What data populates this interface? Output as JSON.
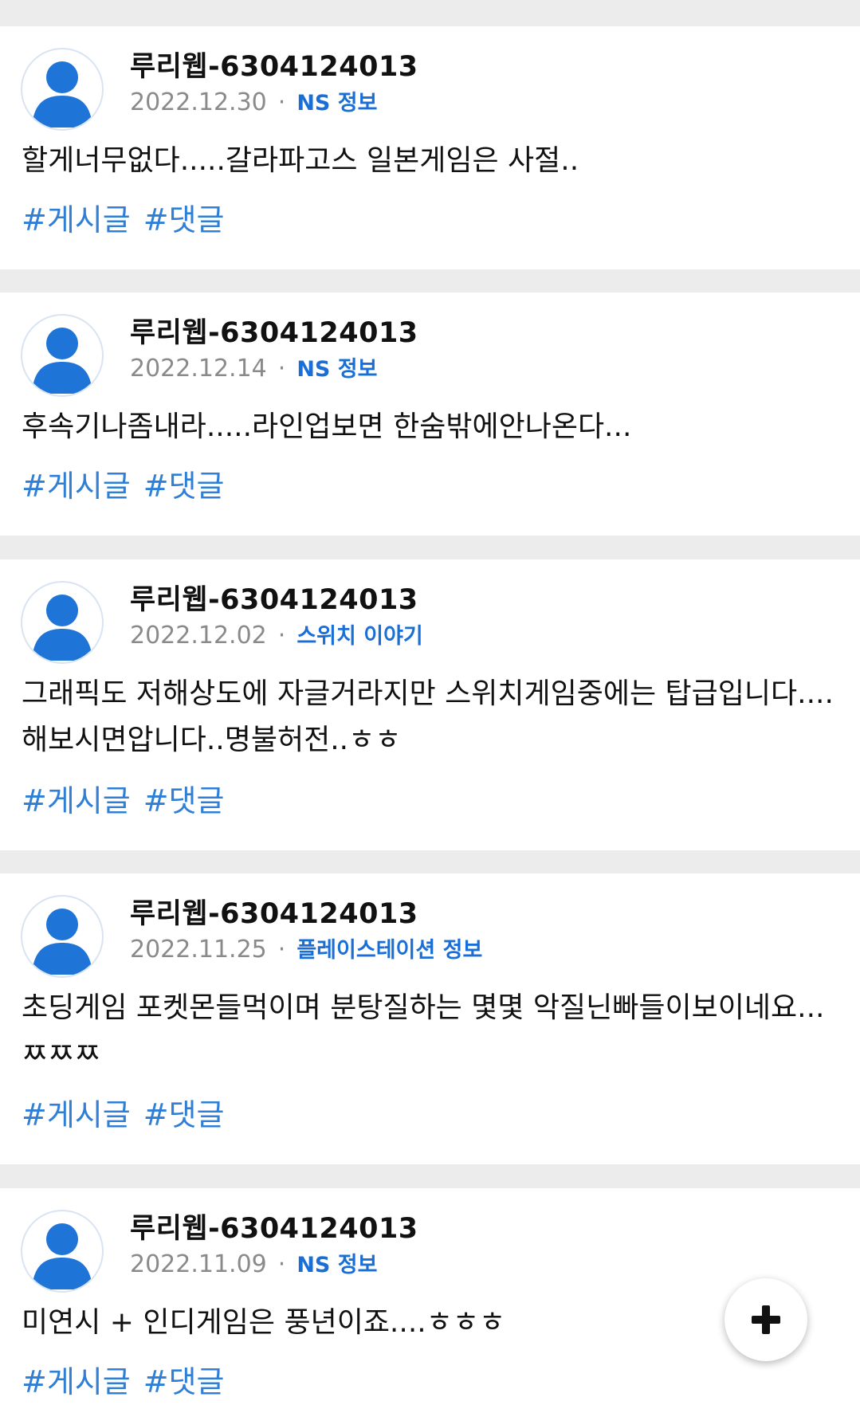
{
  "posts": [
    {
      "author": "루리웹-6304124013",
      "date": "2022.12.30",
      "category": "NS 정보",
      "text": "할게너무없다.....갈라파고스 일본게임은 사절..",
      "tags": [
        "#게시글",
        "#댓글"
      ]
    },
    {
      "author": "루리웹-6304124013",
      "date": "2022.12.14",
      "category": "NS 정보",
      "text": "후속기나좀내라.....라인업보면 한숨밖에안나온다...",
      "tags": [
        "#게시글",
        "#댓글"
      ]
    },
    {
      "author": "루리웹-6304124013",
      "date": "2022.12.02",
      "category": "스위치 이야기",
      "text": "그래픽도 저해상도에 자글거라지만 스위치게임중에는 탑급입니다....해보시면압니다..명불허전..ㅎㅎ",
      "tags": [
        "#게시글",
        "#댓글"
      ]
    },
    {
      "author": "루리웹-6304124013",
      "date": "2022.11.25",
      "category": "플레이스테이션 정보",
      "text": "초딩게임 포켓몬들먹이며 분탕질하는 몇몇 악질닌빠들이보이네요...ㅉㅉㅉ",
      "tags": [
        "#게시글",
        "#댓글"
      ]
    },
    {
      "author": "루리웹-6304124013",
      "date": "2022.11.09",
      "category": "NS 정보",
      "text": "미연시 + 인디게임은 풍년이죠....ㅎㅎㅎ",
      "tags": [
        "#게시글",
        "#댓글"
      ]
    }
  ],
  "separator": "·",
  "fab": {
    "icon": "plus-icon"
  },
  "colors": {
    "accent": "#1a6fd6",
    "tag": "#2f7fd6",
    "avatar": "#1f74d8",
    "background": "#ececec"
  }
}
